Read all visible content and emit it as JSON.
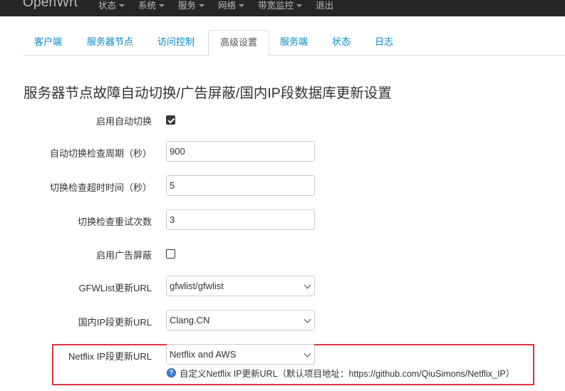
{
  "navbar": {
    "brand": "OpenWrt",
    "menu": [
      {
        "label": "状态",
        "dropdown": true
      },
      {
        "label": "系统",
        "dropdown": true
      },
      {
        "label": "服务",
        "dropdown": true
      },
      {
        "label": "网络",
        "dropdown": true
      },
      {
        "label": "带宽监控",
        "dropdown": true
      },
      {
        "label": "退出",
        "dropdown": false
      }
    ]
  },
  "tabs": [
    {
      "label": "客户端",
      "active": false
    },
    {
      "label": "服务器节点",
      "active": false
    },
    {
      "label": "访问控制",
      "active": false
    },
    {
      "label": "高级设置",
      "active": true
    },
    {
      "label": "服务端",
      "active": false
    },
    {
      "label": "状态",
      "active": false
    },
    {
      "label": "日志",
      "active": false
    }
  ],
  "section_title": "服务器节点故障自动切换/广告屏蔽/国内IP段数据库更新设置",
  "form": {
    "auto_switch": {
      "label": "启用自动切换",
      "checked": true
    },
    "check_interval": {
      "label": "自动切换检查周期（秒）",
      "value": "900"
    },
    "check_timeout": {
      "label": "切换检查超时时间（秒）",
      "value": "5"
    },
    "retry_count": {
      "label": "切换检查重试次数",
      "value": "3"
    },
    "ad_block": {
      "label": "启用广告屏蔽",
      "checked": false
    },
    "gfwlist_url": {
      "label": "GFWList更新URL",
      "value": "gfwlist/gfwlist"
    },
    "china_ip_url": {
      "label": "国内IP段更新URL",
      "value": "Clang.CN"
    },
    "netflix_ip_url": {
      "label": "Netflix IP段更新URL",
      "value": "Netflix and AWS",
      "help": "自定义Netflix IP更新URL（默认项目地址：https://github.com/QiuSimons/Netflix_IP）"
    }
  },
  "colors": {
    "navbar_bg": "#262626",
    "link": "#0088cc",
    "highlight_border": "#d9363e",
    "help_icon": "#3d7fd8"
  }
}
